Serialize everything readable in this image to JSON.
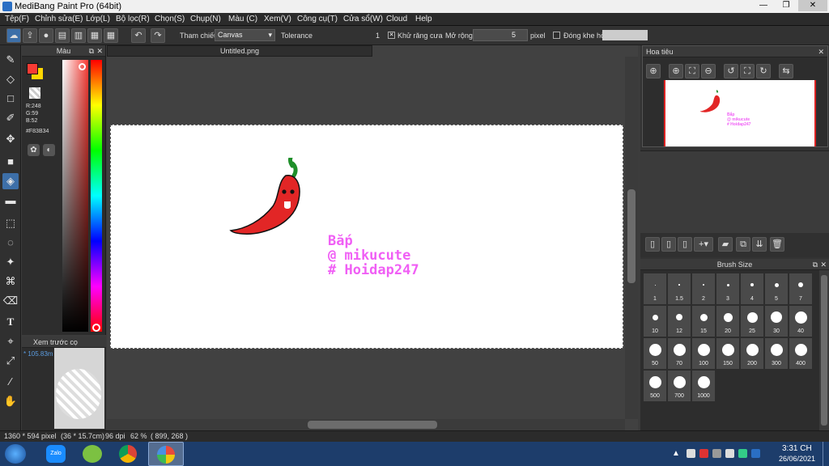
{
  "window": {
    "title": "MediBang Paint Pro (64bit)",
    "minimize": "—",
    "restore": "❐",
    "close": "✕"
  },
  "menubar": [
    "Tệp(F)",
    "Chỉnh sửa(E)",
    "Lớp(L)",
    "Bộ lọc(R)",
    "Chọn(S)",
    "Chụp(N)",
    "Màu (C)",
    "Xem(V)",
    "Công cụ(T)",
    "Cửa sổ(W)",
    "Cloud",
    "Help"
  ],
  "toolbar": {
    "reference_label": "Tham chiếu",
    "reference_value": "Canvas",
    "tolerance_label": "Tolerance",
    "tolerance_value": "1",
    "antialias_label": "Khử răng cưa",
    "antialias_checked": "✕",
    "expand_label": "Mở rộng",
    "expand_value": "5",
    "expand_unit": "pixel",
    "close_gap_label": "Đóng khe hở"
  },
  "color_panel": {
    "title": "Màu",
    "primary_color": "#F83B34",
    "secondary_color": "#FFD700",
    "r": "R:248",
    "g": "G:59",
    "b": "B:52",
    "hex": "#F83B34"
  },
  "brush_preview": {
    "title": "Xem trước cọ",
    "size": "* 105.83m"
  },
  "document": {
    "tab_title": "Untitled.png"
  },
  "canvas_text": {
    "line1": "Bắp",
    "line2": "@ mikucute",
    "line3": "# Hoidap247"
  },
  "navigator": {
    "title": "Hoa tiêu",
    "mini_line1": "Bắp",
    "mini_line2": "@ mikucute",
    "mini_line3": "# Hoidap247"
  },
  "brush_size": {
    "title": "Brush Size",
    "sizes": [
      "1",
      "1.5",
      "2",
      "3",
      "4",
      "5",
      "7",
      "10",
      "12",
      "15",
      "20",
      "25",
      "30",
      "40",
      "50",
      "70",
      "100",
      "150",
      "200",
      "300",
      "400",
      "500",
      "700",
      "1000"
    ]
  },
  "status": {
    "dimensions": "1360 * 594 pixel",
    "physical": "(36 * 15.7cm)",
    "dpi": "96 dpi",
    "zoom": "62 %",
    "coords": "( 899, 268 )"
  },
  "taskbar": {
    "time": "3:31 CH",
    "date": "26/06/2021",
    "zalo": "Zalo"
  }
}
